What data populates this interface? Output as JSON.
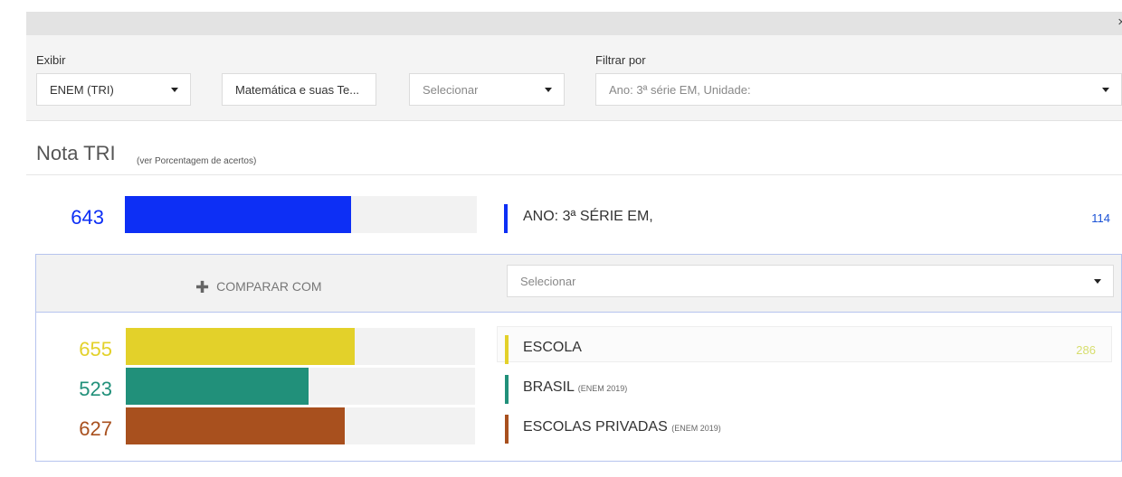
{
  "close_label": "×",
  "filters": {
    "display_label": "Exibir",
    "filter_label": "Filtrar por",
    "select1": "ENEM (TRI)",
    "select2": "Matemática e suas Te...",
    "select3": "Selecionar",
    "filter_select": "Ano: 3ª série EM, Unidade:"
  },
  "section": {
    "title": "Nota TRI",
    "subtitle": "(ver Porcentagem de acertos)"
  },
  "main_row": {
    "value": "643",
    "color": "#0d2ff5",
    "fill": 0.643,
    "label": "ANO: 3ª SÉRIE EM,",
    "count": "114",
    "count_color": "#1a52d6"
  },
  "compare": {
    "button_label": "COMPARAR COM",
    "select_placeholder": "Selecionar"
  },
  "rows": [
    {
      "value": "655",
      "color": "#e3d12a",
      "fill": 0.655,
      "label": "ESCOLA",
      "suffix": "",
      "count": "286",
      "count_color": "#d7de6e"
    },
    {
      "value": "523",
      "color": "#21907a",
      "fill": 0.523,
      "label": "BRASIL",
      "suffix": "(ENEM 2019)",
      "count": "",
      "count_color": ""
    },
    {
      "value": "627",
      "color": "#a8501e",
      "fill": 0.627,
      "label": "ESCOLAS PRIVADAS",
      "suffix": "(ENEM 2019)",
      "count": "",
      "count_color": ""
    }
  ]
}
